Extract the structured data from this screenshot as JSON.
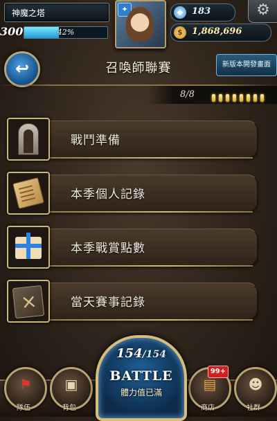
{
  "hud": {
    "game_title": "神魔之塔",
    "level": "300",
    "exp_percent": 42,
    "exp_text": "42%",
    "gems": "183",
    "coins": "1,868,696"
  },
  "header": {
    "title": "召喚師聯賽",
    "dev_button": "新版本開發畫面"
  },
  "tickets": {
    "count_text": "8/8",
    "current": 8,
    "max": 8
  },
  "menu": [
    {
      "label": "戰鬥準備",
      "icon": "door-icon"
    },
    {
      "label": "本季個人記錄",
      "icon": "scroll-icon"
    },
    {
      "label": "本季戰賞點數",
      "icon": "gift-icon"
    },
    {
      "label": "當天賽事記錄",
      "icon": "book-icon"
    }
  ],
  "battle": {
    "stamina_current": "154",
    "stamina_max": "/154",
    "label": "BATTLE",
    "sub": "體力值已滿"
  },
  "nav": {
    "team": "隊伍",
    "bag": "背包",
    "shop": "商店",
    "social": "社群",
    "shop_badge": "99+"
  },
  "colors": {
    "accent_gold": "#cdb57e",
    "exp_blue": "#1e9ad3",
    "badge_red": "#d61d1d"
  }
}
